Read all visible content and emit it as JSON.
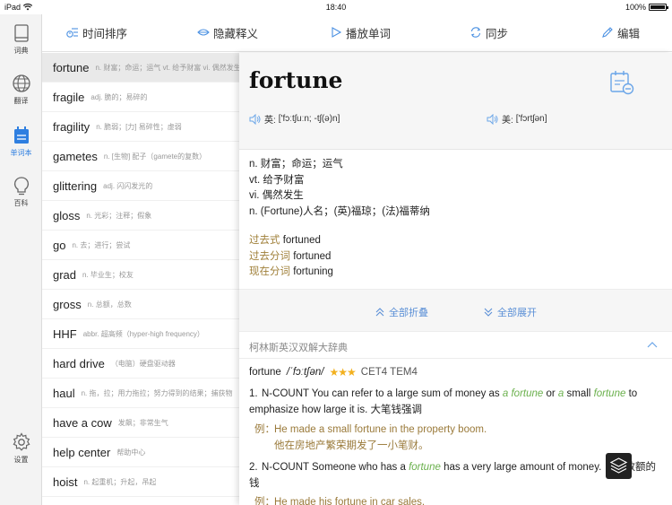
{
  "status": {
    "device": "iPad",
    "time": "18:40",
    "battery": "100%"
  },
  "rail": [
    {
      "label": "词典",
      "icon": "book-icon"
    },
    {
      "label": "翻译",
      "icon": "globe-icon"
    },
    {
      "label": "单词本",
      "icon": "notebook-icon",
      "active": true
    },
    {
      "label": "百科",
      "icon": "bulb-icon"
    },
    {
      "label": "设置",
      "icon": "gear-icon"
    }
  ],
  "toolbar": {
    "sort": "时间排序",
    "hide": "隐藏释义",
    "play": "播放单词",
    "sync": "同步",
    "edit": "编辑"
  },
  "words": [
    {
      "word": "fortune",
      "def": "n. 财富；命运；运气 vt. 给予财富 vi. 偶然发生"
    },
    {
      "word": "fragile",
      "def": "adj. 脆的；易碎的"
    },
    {
      "word": "fragility",
      "def": "n. 脆弱；[力] 易碎性；虚弱"
    },
    {
      "word": "gametes",
      "def": "n. [生物] 配子（gamete的复数）"
    },
    {
      "word": "glittering",
      "def": "adj. 闪闪发光的"
    },
    {
      "word": "gloss",
      "def": "n. 光彩；注释；假象"
    },
    {
      "word": "go",
      "def": "n. 去；进行；尝试"
    },
    {
      "word": "grad",
      "def": "n. 毕业生；校友"
    },
    {
      "word": "gross",
      "def": "n. 总额，总数"
    },
    {
      "word": "HHF",
      "def": "abbr. 超高频（hyper-high frequency）"
    },
    {
      "word": "hard drive",
      "def": "（电脑）硬盘驱动器"
    },
    {
      "word": "haul",
      "def": "n. 拖，拉；用力拖拉；努力得到的结果；捕获物"
    },
    {
      "word": "have a cow",
      "def": "发飙；非常生气"
    },
    {
      "word": "help center",
      "def": "帮助中心"
    },
    {
      "word": "hoist",
      "def": "n. 起重机；升起，吊起"
    }
  ],
  "detail": {
    "word": "fortune",
    "uk_label": "英:",
    "uk_phonetic": "['fɔːtʃuːn; -tʃ(ə)n]",
    "us_label": "美:",
    "us_phonetic": "['fɔrtʃən]",
    "definitions": [
      "n. 财富；命运；运气",
      "vt. 给予财富",
      "vi. 偶然发生",
      "n. (Fortune)人名；(英)福琼；(法)福蒂纳"
    ],
    "forms": [
      {
        "label": "过去式",
        "value": "fortuned"
      },
      {
        "label": "过去分词",
        "value": "fortuned"
      },
      {
        "label": "现在分词",
        "value": "fortuning"
      }
    ],
    "collapse_all": "全部折叠",
    "expand_all": "全部展开",
    "dict_title": "柯林斯英汉双解大辞典",
    "entry_word": "fortune",
    "entry_pron": "/ˈfɔːtʃən/",
    "entry_stars": "★★★",
    "entry_level": "CET4 TEM4",
    "sense1": {
      "num": "1.",
      "pre": "N-COUNT You can refer to a large sum of money as ",
      "kw1": "a fortune",
      "mid": " or ",
      "kw2": "a",
      "mid2": " small ",
      "kw3": "fortune",
      "post": " to emphasize how large it is. 大笔钱强调",
      "ex_label": "例：",
      "ex_en": "He made a small fortune in the property boom.",
      "ex_zh": "他在房地产繁荣期发了一小笔财。"
    },
    "sense2": {
      "num": "2.",
      "pre": "N-COUNT Someone who has a ",
      "kw": "fortune",
      "post": " has a very large amount of money. 巨额数额的钱",
      "ex_label": "例：",
      "ex_en": "He made his fortune in car sales."
    }
  }
}
